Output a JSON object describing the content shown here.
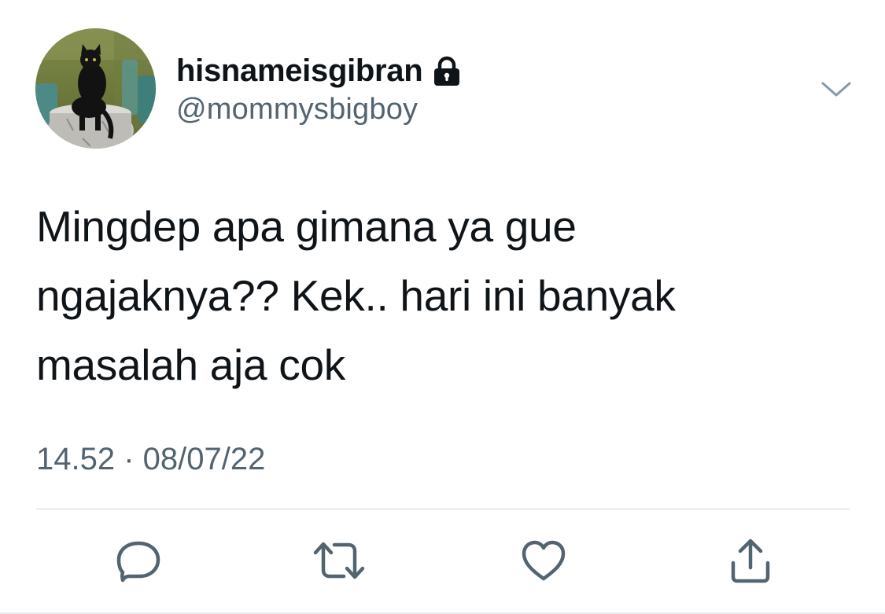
{
  "tweet": {
    "author": {
      "display_name": "hisnameisgibran",
      "handle": "@mommysbigboy",
      "protected_icon": "lock-icon",
      "avatar_description": "black-cat-avatar"
    },
    "text": "Mingdep apa gimana ya gue\nngajaknya?? Kek.. hari ini banyak\nmasalah aja cok",
    "timestamp": "14.52 · 08/07/22",
    "menu_icon": "chevron-down-icon"
  },
  "actions": {
    "reply_icon": "reply-icon",
    "retweet_icon": "retweet-icon",
    "like_icon": "heart-icon",
    "share_icon": "share-icon"
  },
  "colors": {
    "text_primary": "#0f1419",
    "text_secondary": "#536471",
    "icon": "#536471",
    "divider": "#cfd9de",
    "background": "#ffffff"
  }
}
